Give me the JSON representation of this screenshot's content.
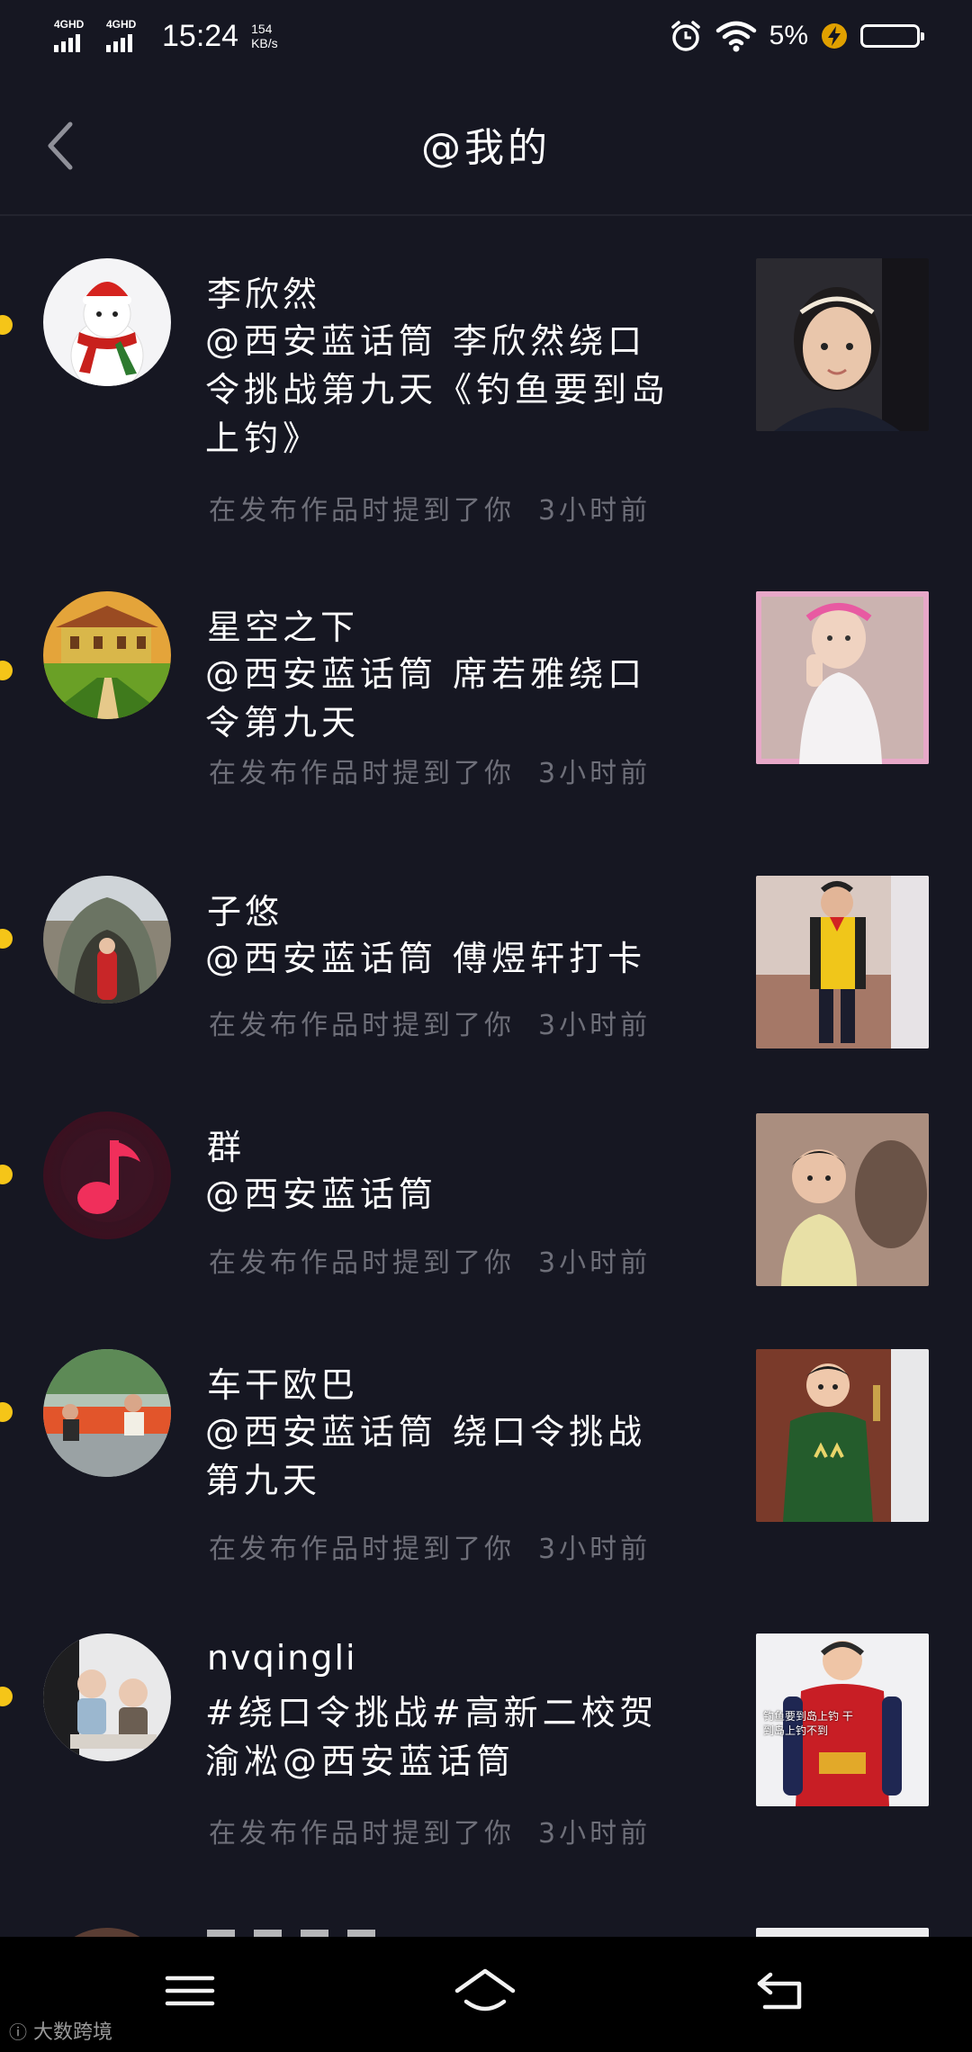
{
  "status_bar": {
    "net1": "4GHD",
    "net2": "4GHD",
    "time": "15:24",
    "speed_value": "154",
    "speed_unit": "KB/s",
    "battery": "5%"
  },
  "header": {
    "title": "@我的",
    "back_icon": "chevron-left-icon"
  },
  "items": [
    {
      "username": "李欣然",
      "desc": "@西安蓝话筒 李欣然绕口令挑战第九天《钓鱼要到岛上钓》",
      "action": "在发布作品时提到了你",
      "time": "3小时前",
      "avatar": "snowman-avatar"
    },
    {
      "username": "星空之下",
      "desc": "@西安蓝话筒 席若雅绕口令第九天",
      "action": "在发布作品时提到了你",
      "time": "3小时前",
      "avatar": "villa-avatar"
    },
    {
      "username": "子悠",
      "desc": "@西安蓝话筒 傅煜轩打卡",
      "action": "在发布作品时提到了你",
      "time": "3小时前",
      "avatar": "dinosaur-avatar"
    },
    {
      "username": "群",
      "desc": "@西安蓝话筒",
      "action": "在发布作品时提到了你",
      "time": "3小时前",
      "avatar": "music-note-avatar"
    },
    {
      "username": "车干欧巴",
      "desc": "@西安蓝话筒 绕口令挑战第九天",
      "action": "在发布作品时提到了你",
      "time": "3小时前",
      "avatar": "family-avatar"
    },
    {
      "username": "nvqingli",
      "desc": "#绕口令挑战#高新二校贺渝凇@西安蓝话筒",
      "action": "在发布作品时提到了你",
      "time": "3小时前",
      "avatar": "kids-avatar"
    }
  ],
  "thumb6_caption": "钓鱼要到岛上钓 干到岛上钓不到",
  "nav": {
    "menu_icon": "menu-icon",
    "home_icon": "home-icon",
    "back_icon": "back-icon"
  },
  "watermark": "大数跨境",
  "colors": {
    "background": "#161722",
    "accent_dot": "#f5c518",
    "meta_text": "#6e6f79"
  }
}
